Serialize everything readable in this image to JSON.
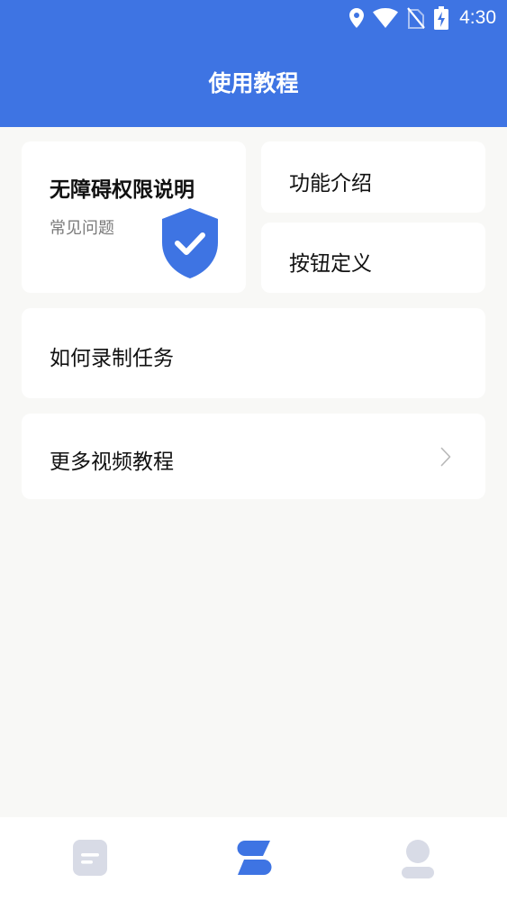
{
  "status_bar": {
    "time": "4:30",
    "icons": [
      "location-icon",
      "wifi-icon",
      "no-sim-icon",
      "battery-charging-icon"
    ]
  },
  "header": {
    "title": "使用教程"
  },
  "cards": {
    "accessibility": {
      "title": "无障碍权限说明",
      "subtitle": "常见问题",
      "icon": "shield-check-icon"
    },
    "features": {
      "label": "功能介绍"
    },
    "buttons": {
      "label": "按钮定义"
    },
    "recording": {
      "label": "如何录制任务"
    },
    "more_videos": {
      "label": "更多视频教程",
      "icon": "chevron-right-icon"
    }
  },
  "bottom_nav": {
    "items": [
      {
        "icon": "document-icon",
        "active": false
      },
      {
        "icon": "tutorial-icon",
        "active": true
      },
      {
        "icon": "profile-icon",
        "active": false
      }
    ]
  },
  "colors": {
    "accent": "#3e74e3",
    "background": "#f8f8f6",
    "inactive_icon": "#d8dbe6"
  }
}
